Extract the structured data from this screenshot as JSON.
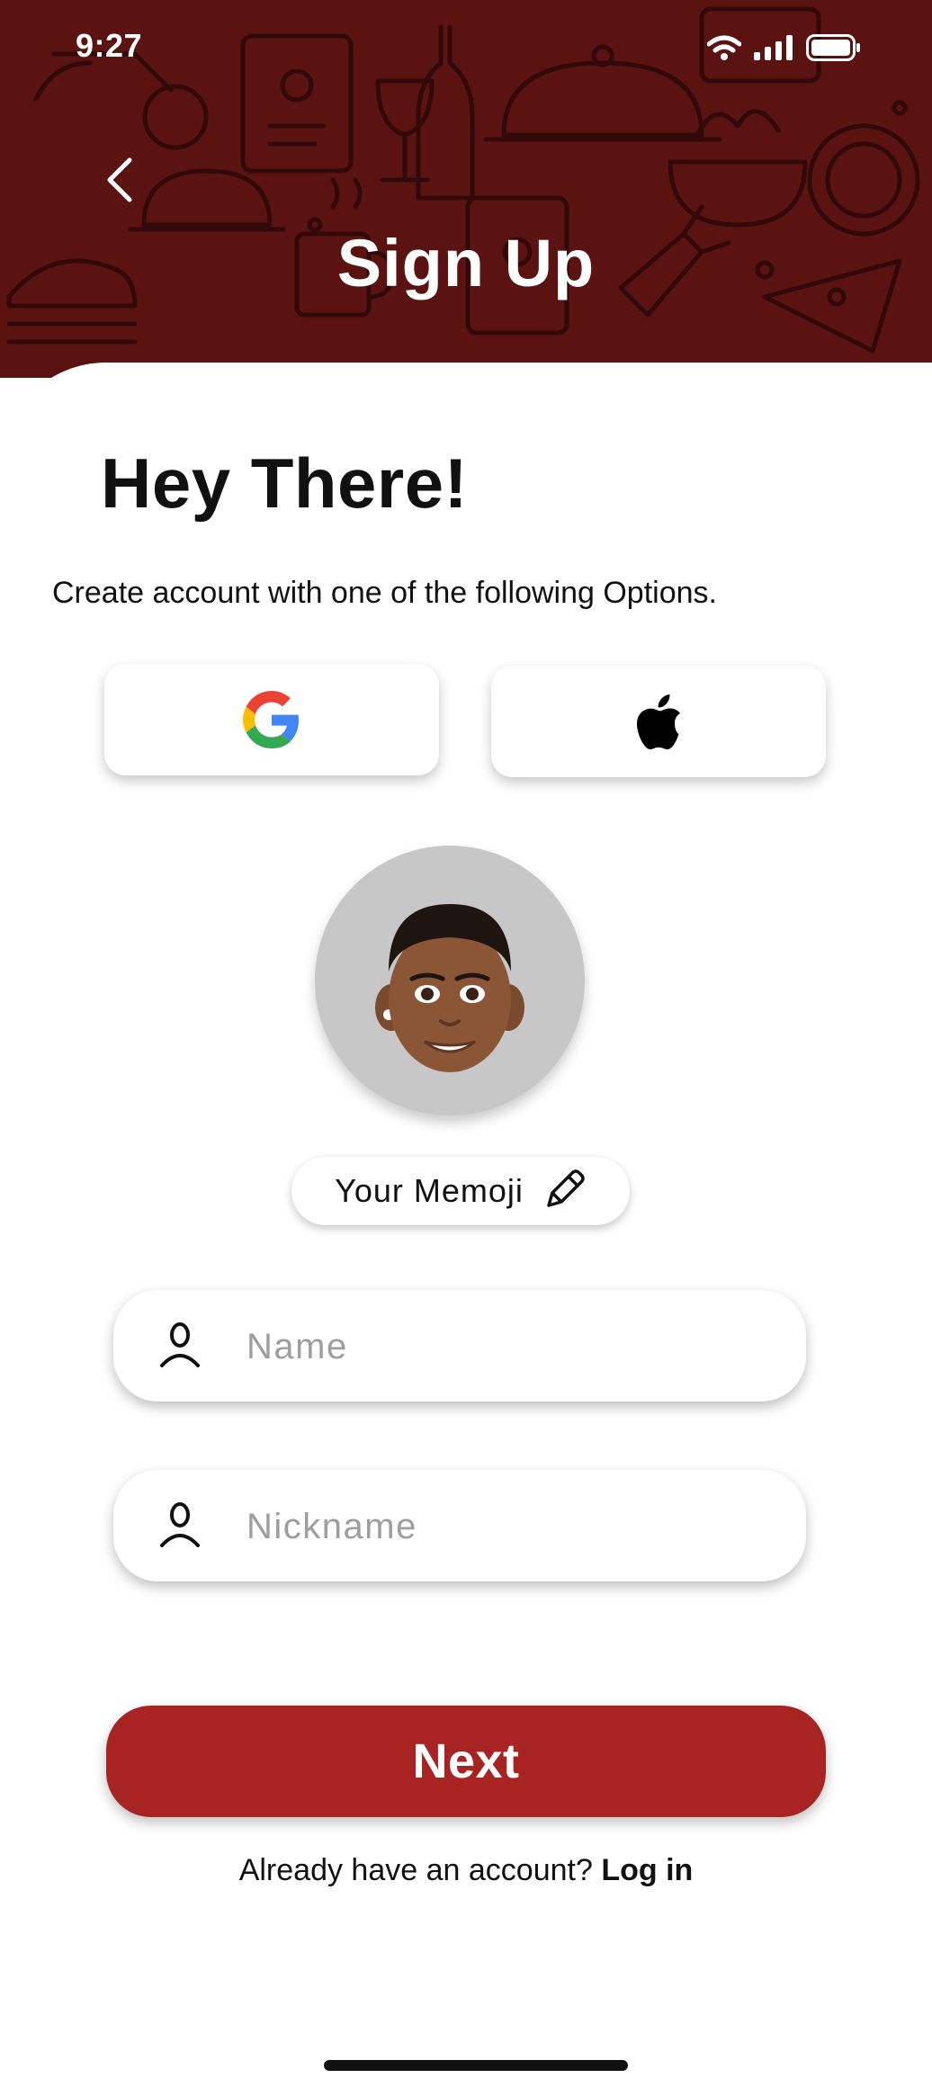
{
  "status_bar": {
    "time": "9:27"
  },
  "header": {
    "title": "Sign Up"
  },
  "intro": {
    "greeting": "Hey There!",
    "subtitle": "Create account with one of the following Options."
  },
  "social": {
    "google_icon": "google-logo",
    "apple_icon": "apple-logo"
  },
  "memoji": {
    "label": "Your Memoji",
    "edit_icon": "pencil-icon"
  },
  "form": {
    "name_placeholder": "Name",
    "name_value": "",
    "nickname_placeholder": "Nickname",
    "nickname_value": ""
  },
  "actions": {
    "next_label": "Next",
    "login_prompt": "Already have an account?",
    "login_link": "Log in"
  },
  "colors": {
    "header_bg": "#5a1311",
    "primary": "#a82422"
  }
}
